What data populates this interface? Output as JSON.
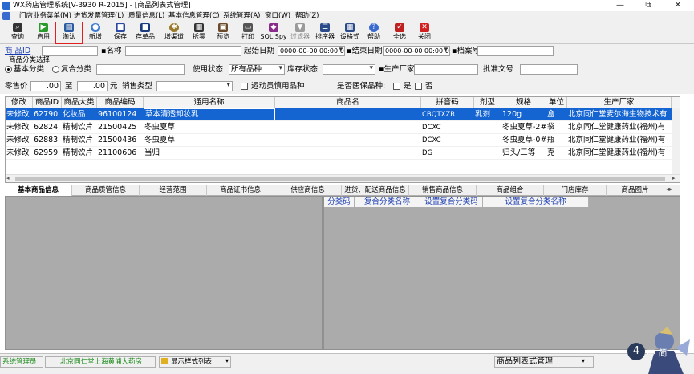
{
  "window": {
    "title": "WX药店管理系统[V-3930 R-2015] - [商品列表式管理]",
    "minimize": "—",
    "restore": "⧉",
    "close": "✕"
  },
  "menu": [
    "门店业务菜单(M)",
    "进货发票管理(L)",
    "质量信息(L)",
    "基本信息管理(C)",
    "系统管理(A)",
    "窗口(W)",
    "帮助(Z)"
  ],
  "toolbar": [
    {
      "label": "查询",
      "icon": "binoculars-icon",
      "color": "#333333"
    },
    {
      "label": "启用",
      "icon": "play-icon",
      "color": "#2a9a2a"
    },
    {
      "label": "淘汰",
      "icon": "book-icon",
      "color": "#2a5aa0"
    },
    {
      "label": "新增",
      "icon": "globe-icon",
      "color": "#3a7ad0"
    },
    {
      "label": "保存",
      "icon": "save-icon",
      "color": "#2a4aa0"
    },
    {
      "label": "存单品",
      "icon": "save-item-icon",
      "color": "#1a3a80"
    },
    {
      "label": "增渠道",
      "icon": "gear-icon",
      "color": "#9a7a2a"
    },
    {
      "label": "拆零",
      "icon": "film-icon",
      "color": "#333333"
    },
    {
      "label": "预览",
      "icon": "preview-icon",
      "color": "#6a4a2a"
    },
    {
      "label": "打印",
      "icon": "printer-icon",
      "color": "#555555"
    },
    {
      "label": "SQL Spy",
      "icon": "sql-spy-icon",
      "color": "#8a2a8a"
    },
    {
      "label": "过滤器",
      "icon": "filter-icon",
      "color": "#9a9a9a"
    },
    {
      "label": "排序器",
      "icon": "sorter-icon",
      "color": "#2a4a8a"
    },
    {
      "label": "设格式",
      "icon": "format-icon",
      "color": "#2a4a8a"
    },
    {
      "label": "帮助",
      "icon": "help-icon",
      "color": "#3a6ad0"
    },
    {
      "label": "全选",
      "icon": "select-all-icon",
      "color": "#c02020"
    },
    {
      "label": "关闭",
      "icon": "close-icon",
      "color": "#d02020"
    }
  ],
  "filter": {
    "product_id_label": "商 品ID",
    "name_label": "名称",
    "start_date_label": "起始日期",
    "start_date_value": "0000-00-00 00:00:00",
    "end_date_label": "结束日期",
    "end_date_value": "0000-00-00 00:00:00",
    "record_no_label": "档案号",
    "category_group_label": "商品分类选择",
    "radio_basic": "基本分类",
    "radio_composite": "复合分类",
    "usage_status_label": "使用状态",
    "usage_status_value": "所有品种",
    "stock_status_label": "库存状态",
    "manufacturer_label": "生产厂家",
    "approval_label": "批准文号",
    "retail_price_label": "零售价",
    "retail_price_from": ".00",
    "to_label": "至",
    "retail_price_to": ".00",
    "yuan_label": "元",
    "sales_type_label": "销售类型",
    "athlete_label": "运动员慎用品种",
    "medical_insurance_label": "是否医保品种:",
    "yes_label": "是",
    "no_label": "否"
  },
  "grid": {
    "columns": [
      "修改",
      "商品ID",
      "商品大类",
      "商品编码",
      "通用名称",
      "商品名",
      "拼音码",
      "剂型",
      "规格",
      "单位",
      "生产厂家"
    ],
    "rows": [
      [
        "未修改",
        "62790",
        "化妆品",
        "96100124",
        "草本清透卸妆乳",
        "",
        "CBQTXZR",
        "乳剂",
        "120g",
        "盒",
        "北京同仁堂麦尔海生物技术有"
      ],
      [
        "未修改",
        "62824",
        "精制饮片",
        "21500425",
        "冬虫夏草",
        "",
        "DCXC",
        "",
        "冬虫夏草-2#",
        "袋",
        "北京同仁堂健康药业(福州)有"
      ],
      [
        "未修改",
        "62883",
        "精制饮片",
        "21500436",
        "冬虫夏草",
        "",
        "DCXC",
        "",
        "冬虫夏草-0#-",
        "瓶",
        "北京同仁堂健康药业(福州)有"
      ],
      [
        "未修改",
        "62959",
        "精制饮片",
        "21100606",
        "当归",
        "",
        "DG",
        "",
        "归头/三等",
        "克",
        "北京同仁堂健康药业(福州)有"
      ]
    ]
  },
  "tabs": [
    "基本商品信息",
    "商品质管信息",
    "经营范围",
    "商品证书信息",
    "供应商信息",
    "进货、配送商品信息",
    "销售商品信息",
    "商品组合",
    "门店库存",
    "商品图片"
  ],
  "composite_header": [
    "分类码",
    "复合分类名称",
    "设置复合分类码",
    "设置复合分类名称"
  ],
  "status": {
    "user": "系统管理员",
    "store": "北京同仁堂上海黄浦大药房",
    "display_style": "显示样式列表",
    "window_name": "商品列表式管理",
    "avatar_badge": "4",
    "ime": "中",
    "ime_mode": "简"
  }
}
